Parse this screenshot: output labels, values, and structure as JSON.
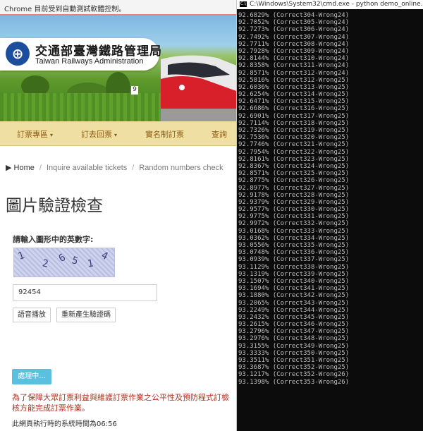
{
  "chrome": {
    "infobar": "Chrome 目前受到自動測試軟體控制。"
  },
  "header": {
    "logo_zh": "交通部臺灣鐵路管理局",
    "logo_en": "Taiwan Railways Administration",
    "banner_number": "9"
  },
  "nav": {
    "items": [
      {
        "label": "訂票專區",
        "caret": "▾"
      },
      {
        "label": "訂去回票",
        "caret": "▾"
      },
      {
        "label": "實名制訂票",
        "caret": ""
      },
      {
        "label": "查詢",
        "caret": ""
      }
    ]
  },
  "breadcrumb": {
    "items": [
      "Home",
      "Inquire available tickets",
      "Random numbers check"
    ],
    "separator": "/"
  },
  "main": {
    "title": "圖片驗證檢查",
    "prompt": "請輸入圖形中的英數字:",
    "captcha_chars": [
      "1",
      "2",
      "6",
      "5",
      "1",
      "4"
    ],
    "captcha_value": "92454",
    "audio_button": "語音播放",
    "refresh_button": "重新產生驗證碼",
    "submit_button": "處理中...",
    "notice": "為了保障大眾訂票利益與維護訂票作業之公平性及預防程式訂檢核方能完成訂票作業。",
    "timer": "此網頁執行時的系統時間為06:56"
  },
  "cmd": {
    "title": "C:\\Windows\\System32\\cmd.exe - python demo_online.py",
    "icon": "C:\\",
    "lines": [
      "92.6829% (Correct304-Wrong24)",
      "92.7052% (Correct305-Wrong24)",
      "92.7273% (Correct306-Wrong24)",
      "92.7492% (Correct307-Wrong24)",
      "92.7711% (Correct308-Wrong24)",
      "92.7928% (Correct309-Wrong24)",
      "92.8144% (Correct310-Wrong24)",
      "92.8358% (Correct311-Wrong24)",
      "92.8571% (Correct312-Wrong24)",
      "92.5816% (Correct312-Wrong25)",
      "92.6036% (Correct313-Wrong25)",
      "92.6254% (Correct314-Wrong25)",
      "92.6471% (Correct315-Wrong25)",
      "92.6686% (Correct316-Wrong25)",
      "92.6901% (Correct317-Wrong25)",
      "92.7114% (Correct318-Wrong25)",
      "92.7326% (Correct319-Wrong25)",
      "92.7536% (Correct320-Wrong25)",
      "92.7746% (Correct321-Wrong25)",
      "92.7954% (Correct322-Wrong25)",
      "92.8161% (Correct323-Wrong25)",
      "92.8367% (Correct324-Wrong25)",
      "92.8571% (Correct325-Wrong25)",
      "92.8775% (Correct326-Wrong25)",
      "92.8977% (Correct327-Wrong25)",
      "92.9178% (Correct328-Wrong25)",
      "92.9379% (Correct329-Wrong25)",
      "92.9577% (Correct330-Wrong25)",
      "92.9775% (Correct331-Wrong25)",
      "92.9972% (Correct332-Wrong25)",
      "93.0168% (Correct333-Wrong25)",
      "93.0362% (Correct334-Wrong25)",
      "93.0556% (Correct335-Wrong25)",
      "93.0748% (Correct336-Wrong25)",
      "93.0939% (Correct337-Wrong25)",
      "93.1129% (Correct338-Wrong25)",
      "93.1319% (Correct339-Wrong25)",
      "93.1507% (Correct340-Wrong25)",
      "93.1694% (Correct341-Wrong25)",
      "93.1880% (Correct342-Wrong25)",
      "93.2065% (Correct343-Wrong25)",
      "93.2249% (Correct344-Wrong25)",
      "93.2432% (Correct345-Wrong25)",
      "93.2615% (Correct346-Wrong25)",
      "93.2796% (Correct347-Wrong25)",
      "93.2976% (Correct348-Wrong25)",
      "93.3155% (Correct349-Wrong25)",
      "93.3333% (Correct350-Wrong25)",
      "93.3511% (Correct351-Wrong25)",
      "93.3687% (Correct352-Wrong25)",
      "93.1217% (Correct352-Wrong26)",
      "93.1398% (Correct353-Wrong26)"
    ]
  },
  "colors": {
    "nav_bg": "#f0dfa2",
    "nav_text": "#8a5a12",
    "submit_bg": "#5bc0de",
    "notice_text": "#b0311d",
    "cmd_bg": "#0c0c0c",
    "cmd_text": "#bfbfbf"
  }
}
